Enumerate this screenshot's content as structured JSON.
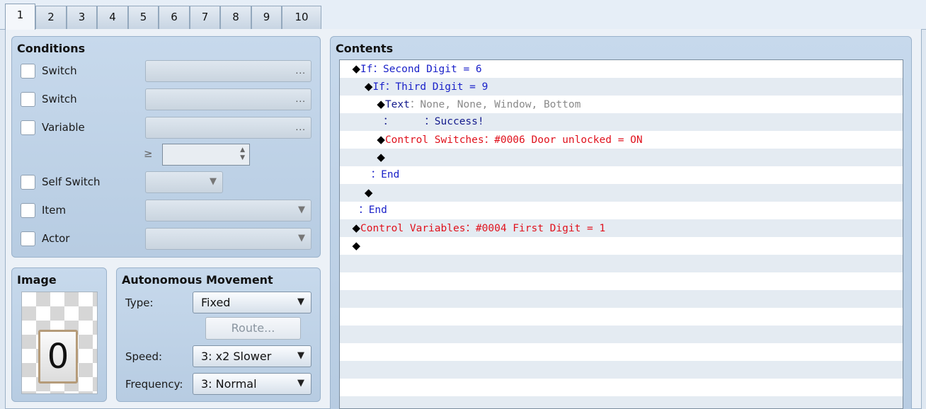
{
  "tabs": [
    "1",
    "2",
    "3",
    "4",
    "5",
    "6",
    "7",
    "8",
    "9",
    "10"
  ],
  "conditions": {
    "title": "Conditions",
    "switch1_label": "Switch",
    "switch2_label": "Switch",
    "variable_label": "Variable",
    "self_switch_label": "Self Switch",
    "item_label": "Item",
    "actor_label": "Actor",
    "dots": "...",
    "geq": "≥",
    "dropdown_arrow": "▼",
    "spin_up": "▲",
    "spin_down": "▼"
  },
  "image": {
    "title": "Image",
    "character": "0"
  },
  "autonomous": {
    "title": "Autonomous Movement",
    "type_label": "Type:",
    "type_value": "Fixed",
    "route_button": "Route...",
    "speed_label": "Speed:",
    "speed_value": "3: x2 Slower",
    "frequency_label": "Frequency:",
    "frequency_value": "3: Normal"
  },
  "contents": {
    "title": "Contents",
    "lines": [
      {
        "indent": "",
        "diamond": "◆",
        "parts": [
          {
            "text": "If：Second Digit = 6",
            "color": "blue"
          }
        ]
      },
      {
        "indent": "  ",
        "diamond": "◆",
        "parts": [
          {
            "text": "If：Third Digit = 9",
            "color": "blue"
          }
        ]
      },
      {
        "indent": "    ",
        "diamond": "◆",
        "parts": [
          {
            "text": "Text",
            "color": "navy"
          },
          {
            "text": "：None, None, Window, Bottom",
            "color": "gray"
          }
        ]
      },
      {
        "indent": "    ",
        "diamond": "",
        "parts": [
          {
            "text": "：     ：Success!",
            "color": "navy"
          }
        ]
      },
      {
        "indent": "    ",
        "diamond": "◆",
        "parts": [
          {
            "text": "Control Switches：#0006 Door unlocked = ON",
            "color": "red"
          }
        ]
      },
      {
        "indent": "    ",
        "diamond": "◆",
        "parts": []
      },
      {
        "indent": "  ",
        "diamond": "",
        "parts": [
          {
            "text": "：End",
            "color": "blue"
          }
        ]
      },
      {
        "indent": "  ",
        "diamond": "◆",
        "parts": []
      },
      {
        "indent": "",
        "diamond": "",
        "parts": [
          {
            "text": "：End",
            "color": "blue"
          }
        ]
      },
      {
        "indent": "",
        "diamond": "◆",
        "parts": [
          {
            "text": "Control Variables：#0004 First Digit = 1",
            "color": "red"
          }
        ]
      },
      {
        "indent": "",
        "diamond": "◆",
        "parts": []
      }
    ]
  },
  "colors": {
    "blue": "#1b22c9",
    "navy": "#131a8c",
    "red": "#e0121d",
    "gray": "#8a8a8a"
  }
}
